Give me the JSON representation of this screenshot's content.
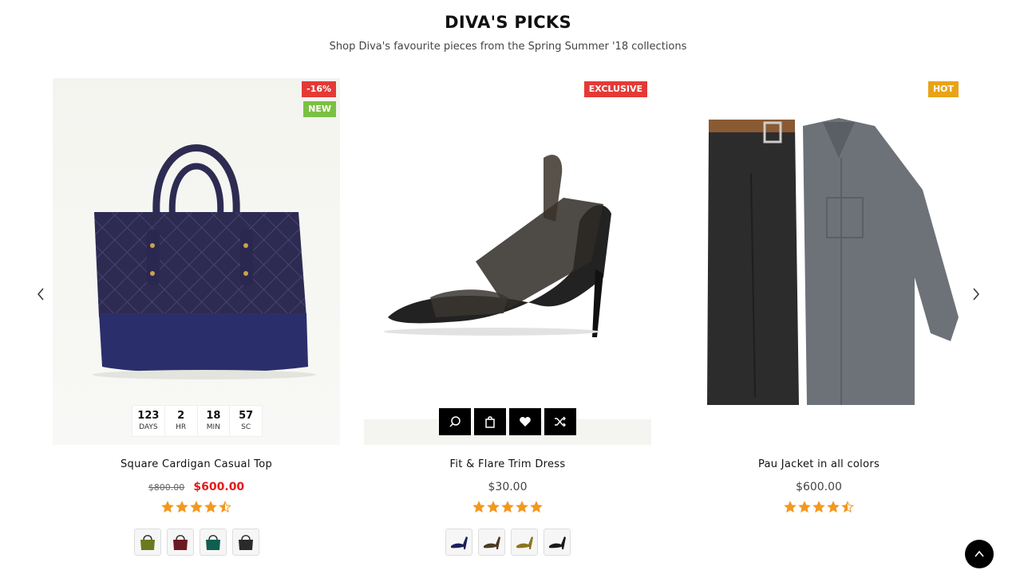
{
  "section": {
    "title": "DIVA'S PICKS",
    "subtitle": "Shop Diva's favourite pieces from the Spring Summer '18 collections"
  },
  "colors": {
    "sale_red": "#e21b1b",
    "badge_red": "#e53935",
    "badge_green": "#7bc043",
    "badge_orange": "#e8a317",
    "star": "#f3981e"
  },
  "products": [
    {
      "name": "Square Cardigan Casual Top",
      "old_price": "$800.00",
      "price": "$600.00",
      "rating": 4.5,
      "badges": [
        {
          "label": "-16%",
          "color": "#e53935"
        },
        {
          "label": "NEW",
          "color": "#7bc043"
        }
      ],
      "countdown": [
        {
          "value": "123",
          "unit": "DAYS"
        },
        {
          "value": "2",
          "unit": "HR"
        },
        {
          "value": "18",
          "unit": "MIN"
        },
        {
          "value": "57",
          "unit": "SC"
        }
      ],
      "swatches": [
        "olive",
        "maroon",
        "teal",
        "black"
      ]
    },
    {
      "name": "Fit & Flare Trim Dress",
      "price": "$30.00",
      "rating": 5,
      "badges": [
        {
          "label": "EXCLUSIVE",
          "color": "#e53935"
        }
      ],
      "actions": [
        "search-icon",
        "bag-icon",
        "heart-icon",
        "shuffle-icon"
      ],
      "swatches": [
        "navy",
        "brown",
        "gold",
        "black"
      ]
    },
    {
      "name": "Pau Jacket in all colors",
      "price": "$600.00",
      "rating": 4.5,
      "badges": [
        {
          "label": "HOT",
          "color": "#e8a317"
        }
      ]
    }
  ]
}
